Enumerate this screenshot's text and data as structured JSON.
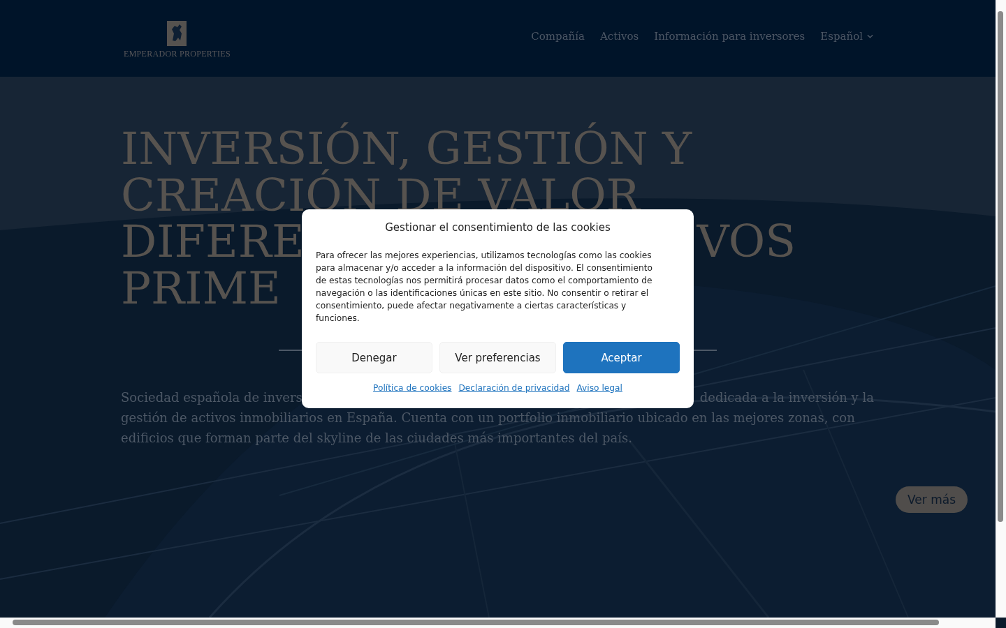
{
  "header": {
    "logo_text": "EMPERADOR PROPERTIES",
    "nav": [
      {
        "label": "Compañía",
        "kind": "link"
      },
      {
        "label": "Activos",
        "kind": "link"
      },
      {
        "label": "Información para inversores",
        "kind": "link"
      },
      {
        "label": "Español",
        "kind": "dropdown"
      }
    ]
  },
  "hero": {
    "heading_lines": [
      [
        "INVERSIÓN, GESTIÓN Y"
      ],
      [
        "CREACIÓN DE VALOR"
      ],
      [
        "DIFERE",
        "VOS"
      ],
      [
        "PRIME"
      ]
    ],
    "intro_lines": [
      [
        "Sociedad española de invers",
        "dedicada a la inversión y la"
      ],
      [
        "gestión de activos inmobiliarios en España. Cuenta con un portfolio inmobiliario ubicado en las mejores zonas, con"
      ],
      [
        "edificios que forman parte del skyline de las ciudades más importantes del país."
      ]
    ],
    "button": "Ver más"
  },
  "cookie_dialog": {
    "title": "Gestionar el consentimiento de las cookies",
    "body": "Para ofrecer las mejores experiencias, utilizamos tecnologías como las cookies para almacenar y/o acceder a la información del dispositivo. El consentimiento de estas tecnologías nos permitirá procesar datos como el comportamiento de navegación o las identificaciones únicas en este sitio. No consentir o retirar el consentimiento, puede afectar negativamente a ciertas características y funciones.",
    "buttons": [
      {
        "label": "Denegar",
        "kind": "secondary"
      },
      {
        "label": "Ver preferencias",
        "kind": "secondary"
      },
      {
        "label": "Aceptar",
        "kind": "primary"
      }
    ],
    "links": [
      "Política de cookies",
      "Declaración de privacidad",
      "Aviso legal"
    ]
  }
}
